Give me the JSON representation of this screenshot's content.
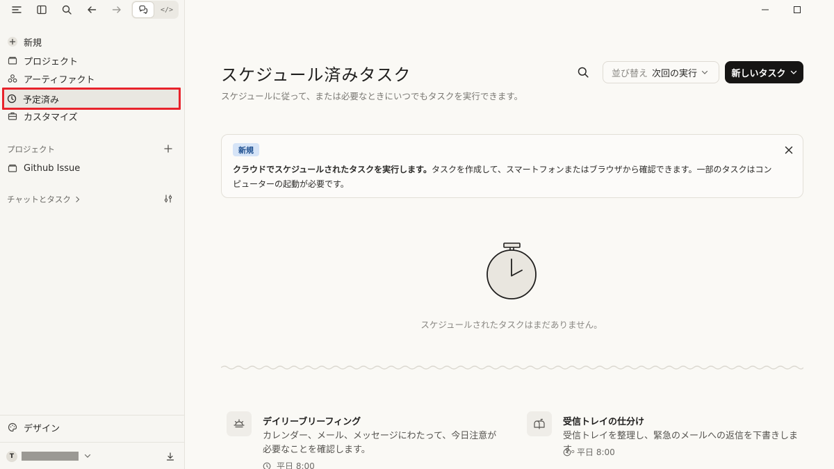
{
  "sidebar": {
    "nav": [
      {
        "label": "新規",
        "icon": "plus-icon"
      },
      {
        "label": "プロジェクト",
        "icon": "folder-icon"
      },
      {
        "label": "アーティファクト",
        "icon": "artifacts-icon"
      },
      {
        "label": "予定済み",
        "icon": "clock-icon",
        "active": true
      },
      {
        "label": "カスタマイズ",
        "icon": "briefcase-icon"
      }
    ],
    "projects_label": "プロジェクト",
    "projects": [
      {
        "label": "Github Issue",
        "icon": "folder-icon"
      }
    ],
    "chats_label": "チャットとタスク",
    "design_label": "デザイン",
    "user_initial": "T"
  },
  "toolbar": {
    "code_label": "</>"
  },
  "main": {
    "title": "スケジュール済みタスク",
    "subtitle": "スケジュールに従って、または必要なときにいつでもタスクを実行できます。",
    "sort_label": "並び替え",
    "sort_value": "次回の実行",
    "new_task_label": "新しいタスク",
    "banner": {
      "badge": "新規",
      "bold_text": "クラウドでスケジュールされたタスクを実行します。",
      "text": "タスクを作成して、スマートフォンまたはブラウザから確認できます。一部のタスクはコンピューターの起動が必要です。"
    },
    "empty_text": "スケジュールされたタスクはまだありません。",
    "cards": [
      {
        "title": "デイリーブリーフィング",
        "desc": "カレンダー、メール、メッセージにわたって、今日注意が必要なことを確認します。",
        "time": "平日 8:00",
        "icon": "sunrise-icon"
      },
      {
        "title": "受信トレイの仕分け",
        "desc": "受信トレイを整理し、緊急のメールへの返信を下書きします。",
        "time": "平日 8:00",
        "icon": "mailbox-icon"
      }
    ]
  },
  "colors": {
    "highlight_border": "#e8232b",
    "badge_bg": "#d6e4f7",
    "primary_button": "#161514"
  }
}
